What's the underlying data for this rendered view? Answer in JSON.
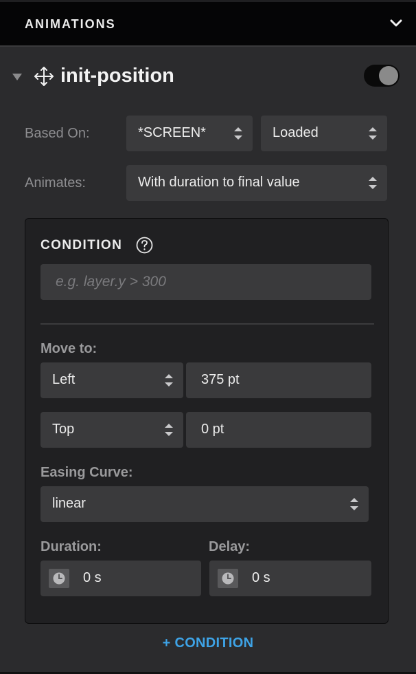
{
  "header": {
    "title": "ANIMATIONS",
    "collapse_icon": "chevron-down-icon"
  },
  "animation": {
    "name": "init-position",
    "enabled": true,
    "based_on_label": "Based On:",
    "based_on_screen": "*SCREEN*",
    "based_on_event": "Loaded",
    "animates_label": "Animates:",
    "animates_value": "With duration to final value"
  },
  "condition": {
    "title": "CONDITION",
    "placeholder": "e.g. layer.y > 300",
    "move_to_label": "Move to:",
    "move_rows": [
      {
        "property": "Left",
        "value": "375 pt"
      },
      {
        "property": "Top",
        "value": "0 pt"
      }
    ],
    "easing_label": "Easing Curve:",
    "easing_value": "linear",
    "duration_label": "Duration:",
    "duration_value": "0 s",
    "delay_label": "Delay:",
    "delay_value": "0 s"
  },
  "add_condition": "+ CONDITION",
  "colors": {
    "accent": "#3ea3e6",
    "panel": "#2b2b2d",
    "field": "#3a3a3c",
    "box": "#202022"
  }
}
